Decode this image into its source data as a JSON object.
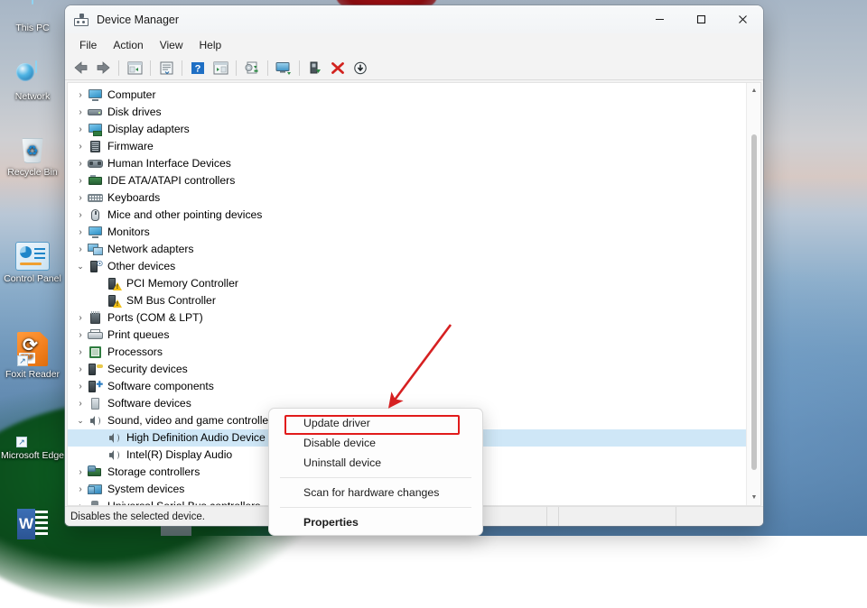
{
  "desktop": {
    "icons": [
      {
        "label": "This PC",
        "icon": "monitor-icon"
      },
      {
        "label": "Network",
        "icon": "network-globe-icon"
      },
      {
        "label": "Recycle Bin",
        "icon": "recycle-bin-icon"
      },
      {
        "label": "Control Panel",
        "icon": "control-panel-icon"
      },
      {
        "label": "Foxit Reader",
        "icon": "foxit-reader-icon"
      },
      {
        "label": "Microsoft\nEdge",
        "icon": "microsoft-edge-icon"
      },
      {
        "label": "",
        "icon": "word-icon"
      }
    ],
    "edge_label_line1": "Microsoft",
    "edge_label_line2": "Edge"
  },
  "window": {
    "title": "Device Manager",
    "app_icon": "device-manager-icon",
    "controls": {
      "minimize": "─",
      "maximize": "☐",
      "close": "✕"
    },
    "menus": [
      "File",
      "Action",
      "View",
      "Help"
    ],
    "toolbar": [
      {
        "name": "back-icon",
        "glyph": "back"
      },
      {
        "name": "forward-icon",
        "glyph": "forward"
      },
      {
        "name": "separator",
        "glyph": "sep"
      },
      {
        "name": "show-hide-console-tree-icon",
        "glyph": "tree"
      },
      {
        "name": "separator",
        "glyph": "sep"
      },
      {
        "name": "properties-icon",
        "glyph": "props"
      },
      {
        "name": "separator",
        "glyph": "sep"
      },
      {
        "name": "help-icon",
        "glyph": "help"
      },
      {
        "name": "show-hide-action-pane-icon",
        "glyph": "pane"
      },
      {
        "name": "separator",
        "glyph": "sep"
      },
      {
        "name": "update-driver-icon",
        "glyph": "update"
      },
      {
        "name": "separator",
        "glyph": "sep"
      },
      {
        "name": "scan-for-hardware-changes-icon",
        "glyph": "scan"
      },
      {
        "name": "separator",
        "glyph": "sep"
      },
      {
        "name": "enable-device-icon",
        "glyph": "enable"
      },
      {
        "name": "uninstall-device-icon",
        "glyph": "uninstall"
      },
      {
        "name": "disable-device-icon",
        "glyph": "disable"
      }
    ]
  },
  "tree": [
    {
      "label": "Computer",
      "icon": "computer-icon",
      "state": "collapsed",
      "level": 1,
      "iconclass": "i-monitor",
      "shape": "monitor"
    },
    {
      "label": "Disk drives",
      "icon": "disk-drives-icon",
      "state": "collapsed",
      "level": 1,
      "iconclass": "i-disk",
      "shape": "disk"
    },
    {
      "label": "Display adapters",
      "icon": "display-adapters-icon",
      "state": "collapsed",
      "level": 1,
      "iconclass": "i-display",
      "shape": "display"
    },
    {
      "label": "Firmware",
      "icon": "firmware-icon",
      "state": "collapsed",
      "level": 1,
      "iconclass": "i-fw",
      "shape": "fw"
    },
    {
      "label": "Human Interface Devices",
      "icon": "human-interface-devices-icon",
      "state": "collapsed",
      "level": 1,
      "iconclass": "i-hid",
      "shape": "hid"
    },
    {
      "label": "IDE ATA/ATAPI controllers",
      "icon": "ide-ata-atapi-controllers-icon",
      "state": "collapsed",
      "level": 1,
      "iconclass": "i-ide",
      "shape": "ide"
    },
    {
      "label": "Keyboards",
      "icon": "keyboards-icon",
      "state": "collapsed",
      "level": 1,
      "iconclass": "i-kb",
      "shape": "kb"
    },
    {
      "label": "Mice and other pointing devices",
      "icon": "mice-icon",
      "state": "collapsed",
      "level": 1,
      "iconclass": "i-mouse",
      "shape": "mouse"
    },
    {
      "label": "Monitors",
      "icon": "monitors-icon",
      "state": "collapsed",
      "level": 1,
      "iconclass": "i-monitor",
      "shape": "monitor"
    },
    {
      "label": "Network adapters",
      "icon": "network-adapters-icon",
      "state": "collapsed",
      "level": 1,
      "iconclass": "i-net",
      "shape": "net"
    },
    {
      "label": "Other devices",
      "icon": "other-devices-icon",
      "state": "expanded",
      "level": 1,
      "iconclass": "i-other",
      "shape": "other"
    },
    {
      "label": "PCI Memory Controller",
      "icon": "warning-device-icon",
      "state": "leaf",
      "level": 2,
      "iconclass": "i-warn",
      "shape": "warn"
    },
    {
      "label": "SM Bus Controller",
      "icon": "warning-device-icon",
      "state": "leaf",
      "level": 2,
      "iconclass": "i-warn",
      "shape": "warn"
    },
    {
      "label": "Ports (COM & LPT)",
      "icon": "ports-icon",
      "state": "collapsed",
      "level": 1,
      "iconclass": "i-port",
      "shape": "port"
    },
    {
      "label": "Print queues",
      "icon": "print-queues-icon",
      "state": "collapsed",
      "level": 1,
      "iconclass": "i-print",
      "shape": "print"
    },
    {
      "label": "Processors",
      "icon": "processors-icon",
      "state": "collapsed",
      "level": 1,
      "iconclass": "i-cpu",
      "shape": "cpu"
    },
    {
      "label": "Security devices",
      "icon": "security-devices-icon",
      "state": "collapsed",
      "level": 1,
      "iconclass": "i-sec",
      "shape": "sec"
    },
    {
      "label": "Software components",
      "icon": "software-components-icon",
      "state": "collapsed",
      "level": 1,
      "iconclass": "i-swc",
      "shape": "swc"
    },
    {
      "label": "Software devices",
      "icon": "software-devices-icon",
      "state": "collapsed",
      "level": 1,
      "iconclass": "i-swd",
      "shape": "swd"
    },
    {
      "label": "Sound, video and game controllers",
      "icon": "sound-video-game-controllers-icon",
      "state": "expanded",
      "level": 1,
      "iconclass": "i-snd",
      "shape": "snd"
    },
    {
      "label": "High Definition Audio Device",
      "icon": "audio-device-icon",
      "state": "leaf",
      "level": 2,
      "iconclass": "i-snd",
      "shape": "snd",
      "selected": true
    },
    {
      "label": "Intel(R) Display Audio",
      "icon": "audio-device-icon",
      "state": "leaf",
      "level": 2,
      "iconclass": "i-snd",
      "shape": "snd"
    },
    {
      "label": "Storage controllers",
      "icon": "storage-controllers-icon",
      "state": "collapsed",
      "level": 1,
      "iconclass": "i-stor",
      "shape": "stor"
    },
    {
      "label": "System devices",
      "icon": "system-devices-icon",
      "state": "collapsed",
      "level": 1,
      "iconclass": "i-sys",
      "shape": "sys"
    },
    {
      "label": "Universal Serial Bus controllers",
      "icon": "usb-controllers-icon",
      "state": "collapsed",
      "level": 1,
      "iconclass": "i-usb",
      "shape": "usb"
    }
  ],
  "context_menu": {
    "items": [
      {
        "label": "Update driver",
        "bold": false,
        "highlighted": true
      },
      {
        "label": "Disable device",
        "bold": false
      },
      {
        "label": "Uninstall device",
        "bold": false
      },
      {
        "separator": true
      },
      {
        "label": "Scan for hardware changes",
        "bold": false
      },
      {
        "separator": true
      },
      {
        "label": "Properties",
        "bold": true
      }
    ]
  },
  "statusbar": {
    "message": "Disables the selected device."
  },
  "annotation": {
    "arrow_color": "#D62021",
    "highlight_color": "#E11B1B",
    "target": "Update driver"
  },
  "colors": {
    "selection": "#CFE7F7",
    "window_chrome": "#F3F3F3",
    "tree_background": "#FFFFFF",
    "accent_red": "#D62021"
  },
  "chevrons": {
    "collapsed": "›",
    "expanded": "⌄"
  }
}
